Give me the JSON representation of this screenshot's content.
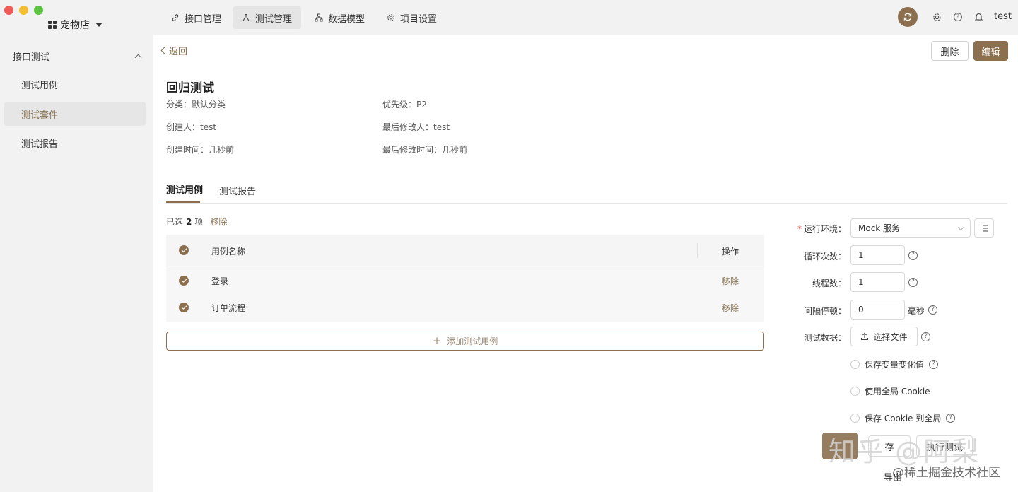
{
  "app": {
    "store_name": "宠物店"
  },
  "sidebar": {
    "group_label": "接口测试",
    "items": [
      {
        "label": "测试用例"
      },
      {
        "label": "测试套件"
      },
      {
        "label": "测试报告"
      }
    ]
  },
  "topnav": {
    "tabs": [
      {
        "label": "接口管理",
        "icon": "link-icon"
      },
      {
        "label": "测试管理",
        "icon": "flask-icon"
      },
      {
        "label": "数据模型",
        "icon": "hierarchy-icon"
      },
      {
        "label": "项目设置",
        "icon": "gear-icon"
      }
    ],
    "active_tab": "测试管理",
    "user": "test"
  },
  "header": {
    "back_label": "返回",
    "delete_label": "删除",
    "edit_label": "编辑"
  },
  "suite": {
    "title": "回归测试",
    "meta": {
      "category": "分类：默认分类",
      "priority": "优先级：P2",
      "creator": "创建人：test",
      "last_modifier": "最后修改人：test",
      "created_time": "创建时间：几秒前",
      "modified_time": "最后修改时间：几秒前"
    }
  },
  "content_tabs": [
    {
      "label": "测试用例"
    },
    {
      "label": "测试报告"
    }
  ],
  "selection": {
    "prefix": "已选",
    "count": "2",
    "suffix": "项",
    "remove_label": "移除"
  },
  "table": {
    "headers": {
      "name": "用例名称",
      "action": "操作"
    },
    "rows": [
      {
        "name": "登录",
        "action": "移除"
      },
      {
        "name": "订单流程",
        "action": "移除"
      }
    ],
    "add_label": "添加测试用例"
  },
  "run_config": {
    "env_label": "运行环境：",
    "env_value": "Mock 服务",
    "loop_label": "循环次数：",
    "loop_value": "1",
    "thread_label": "线程数：",
    "thread_value": "1",
    "interval_label": "间隔停顿：",
    "interval_value": "0",
    "interval_unit": "毫秒",
    "data_label": "测试数据：",
    "file_button": "选择文件",
    "options": [
      {
        "label": "保存变量变化值",
        "help": true
      },
      {
        "label": "使用全局 Cookie",
        "help": false
      },
      {
        "label": "保存 Cookie 到全局",
        "help": true
      }
    ],
    "save_label": "存",
    "run_label": "执行测试",
    "export_label": "导出"
  },
  "watermark": {
    "big": "知乎 @阿梨",
    "small": "@稀土掘金技术社区"
  },
  "colors": {
    "accent": "#8b6f4e",
    "sidebar_bg": "#f2f2f2"
  }
}
